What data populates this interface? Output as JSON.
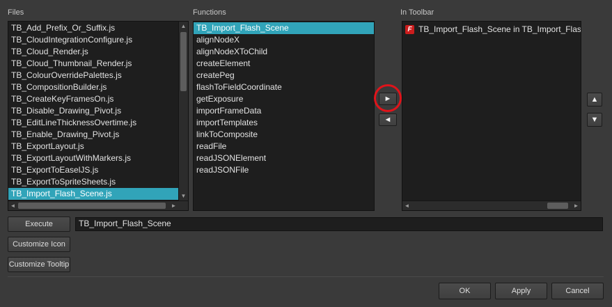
{
  "files": {
    "label": "Files",
    "items": [
      "TB_Add_Prefix_Or_Suffix.js",
      "TB_CloudIntegrationConfigure.js",
      "TB_Cloud_Render.js",
      "TB_Cloud_Thumbnail_Render.js",
      "TB_ColourOverridePalettes.js",
      "TB_CompositionBuilder.js",
      "TB_CreateKeyFramesOn.js",
      "TB_Disable_Drawing_Pivot.js",
      "TB_EditLineThicknessOvertime.js",
      "TB_Enable_Drawing_Pivot.js",
      "TB_ExportLayout.js",
      "TB_ExportLayoutWithMarkers.js",
      "TB_ExportToEaselJS.js",
      "TB_ExportToSpriteSheets.js",
      "TB_Import_Flash_Scene.js"
    ],
    "selected_index": 14
  },
  "functions": {
    "label": "Functions",
    "items": [
      "TB_Import_Flash_Scene",
      "alignNodeX",
      "alignNodeXToChild",
      "createElement",
      "createPeg",
      "flashToFieldCoordinate",
      "getExposure",
      "importFrameData",
      "importTemplates",
      "linkToComposite",
      "readFile",
      "readJSONElement",
      "readJSONFile"
    ],
    "selected_index": 0
  },
  "toolbar": {
    "label": "In Toolbar",
    "items": [
      "TB_Import_Flash_Scene in TB_Import_Flash_S"
    ]
  },
  "buttons": {
    "add_arrow": "►",
    "remove_arrow": "◄",
    "move_up": "▲",
    "move_down": "▼",
    "execute": "Execute",
    "customize_icon": "Customize Icon",
    "customize_tooltip": "Customize Tooltip",
    "ok": "OK",
    "apply": "Apply",
    "cancel": "Cancel"
  },
  "execute_field": {
    "value": "TB_Import_Flash_Scene"
  },
  "icons": {
    "flash": "F"
  },
  "colors": {
    "selection": "#31a4b9",
    "highlight_ring": "#e0131a"
  }
}
